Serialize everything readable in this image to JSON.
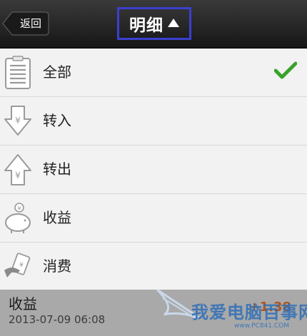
{
  "header": {
    "back_label": "返回",
    "title": "明细"
  },
  "menu": {
    "items": [
      {
        "label": "全部",
        "icon": "clipboard-list-icon",
        "selected": true
      },
      {
        "label": "转入",
        "icon": "arrow-down-yuan-icon",
        "selected": false
      },
      {
        "label": "转出",
        "icon": "arrow-up-yuan-icon",
        "selected": false
      },
      {
        "label": "收益",
        "icon": "piggy-bank-icon",
        "selected": false
      },
      {
        "label": "消费",
        "icon": "payment-card-icon",
        "selected": false
      }
    ]
  },
  "record": {
    "title": "收益",
    "time": "2013-07-09 06:08",
    "amount": "+1.38"
  },
  "watermark": {
    "text": "我爱电脑百事网",
    "url": "www.PC841.COM"
  },
  "colors": {
    "header_bg": "#1c1c1c",
    "title_highlight": "#3b3fd0",
    "check_green": "#3aa12b",
    "amount_orange": "#b3541e"
  }
}
